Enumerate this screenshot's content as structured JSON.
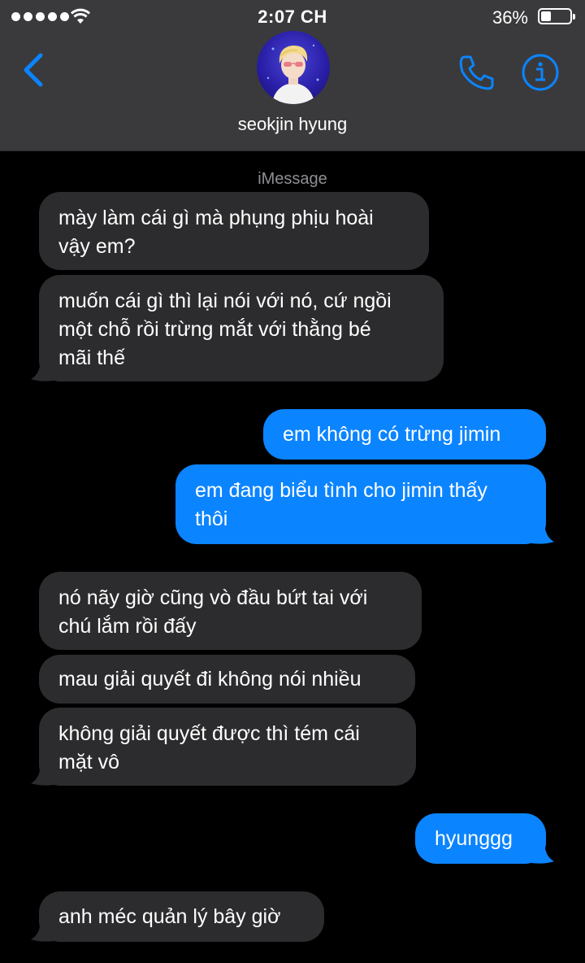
{
  "status_bar": {
    "time": "2:07 CH",
    "battery_percent": "36%",
    "battery_level": 0.36,
    "signal_dots": 5
  },
  "header": {
    "contact_name": "seokjin hyung",
    "icons": [
      "chevron-left-icon",
      "phone-icon",
      "info-icon"
    ],
    "accent_color": "#0b84ff"
  },
  "thread": {
    "service_label": "iMessage",
    "incoming_color": "#2c2c2e",
    "outgoing_color": "#0b84ff",
    "messages": [
      {
        "direction": "incoming",
        "lines": [
          "mày làm cái gì mà phụng phịu hoài",
          "vậy em?"
        ]
      },
      {
        "direction": "incoming",
        "lines": [
          "muốn cái gì thì lại nói với nó, cứ ngồi",
          "một chỗ rồi trừng mắt với thằng bé",
          "mãi thế"
        ]
      },
      {
        "direction": "outgoing",
        "lines": [
          "em không có trừng jimin"
        ]
      },
      {
        "direction": "outgoing",
        "lines": [
          "em đang biểu tình cho jimin thấy",
          "thôi"
        ]
      },
      {
        "direction": "incoming",
        "lines": [
          "nó nãy giờ cũng vò đầu bứt tai với",
          "chú lắm rồi đấy"
        ]
      },
      {
        "direction": "incoming",
        "lines": [
          "mau giải quyết đi không nói nhiều"
        ]
      },
      {
        "direction": "incoming",
        "lines": [
          "không giải quyết được thì tém cái",
          "mặt vô"
        ]
      },
      {
        "direction": "outgoing",
        "lines": [
          "hyunggg"
        ]
      },
      {
        "direction": "incoming",
        "lines": [
          "anh méc quản lý bây giờ"
        ]
      }
    ]
  }
}
